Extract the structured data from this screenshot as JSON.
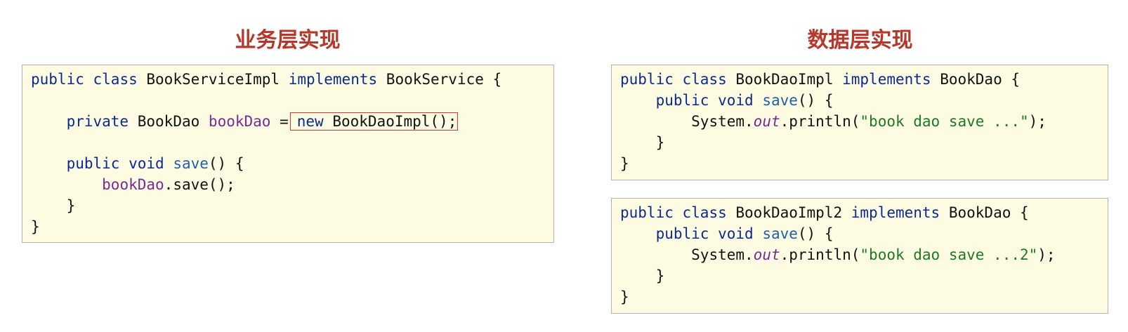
{
  "left": {
    "title": "业务层实现",
    "code": {
      "l1": {
        "kw1": "public",
        "kw2": "class",
        "name": "BookServiceImpl",
        "kw3": "implements",
        "iface": "BookService",
        "brace": "{"
      },
      "l3": {
        "kw": "private",
        "type": "BookDao",
        "field": "bookDao",
        "eq": "=",
        "new_kw": "new",
        "ctor": "BookDaoImpl();"
      },
      "l5": {
        "kw1": "public",
        "kw2": "void",
        "method": "save",
        "rest": "() {"
      },
      "l6": {
        "field": "bookDao",
        "rest": ".save();"
      },
      "l7": {
        "brace": "}"
      },
      "l8": {
        "brace": "}"
      }
    }
  },
  "right": {
    "title": "数据层实现",
    "dao1": {
      "l1": {
        "kw1": "public",
        "kw2": "class",
        "name": "BookDaoImpl",
        "kw3": "implements",
        "iface": "BookDao",
        "brace": "{"
      },
      "l2": {
        "kw1": "public",
        "kw2": "void",
        "method": "save",
        "rest": "() {"
      },
      "l3": {
        "sys": "System.",
        "out": "out",
        "println": ".println(",
        "str": "\"book dao save ...\"",
        "end": ");"
      },
      "l4": {
        "brace": "}"
      },
      "l5": {
        "brace": "}"
      }
    },
    "dao2": {
      "l1": {
        "kw1": "public",
        "kw2": "class",
        "name": "BookDaoImpl2",
        "kw3": "implements",
        "iface": "BookDao",
        "brace": "{"
      },
      "l2": {
        "kw1": "public",
        "kw2": "void",
        "method": "save",
        "rest": "() {"
      },
      "l3": {
        "sys": "System.",
        "out": "out",
        "println": ".println(",
        "str": "\"book dao save ...2\"",
        "end": ");"
      },
      "l4": {
        "brace": "}"
      },
      "l5": {
        "brace": "}"
      }
    }
  },
  "colors": {
    "title": "#b5382a",
    "keyword": "#0b2a8f",
    "method": "#1f5fa8",
    "field": "#7a2a96",
    "string": "#1b7a23",
    "highlight_border": "#e0343a",
    "code_background": "#fdfce2"
  }
}
